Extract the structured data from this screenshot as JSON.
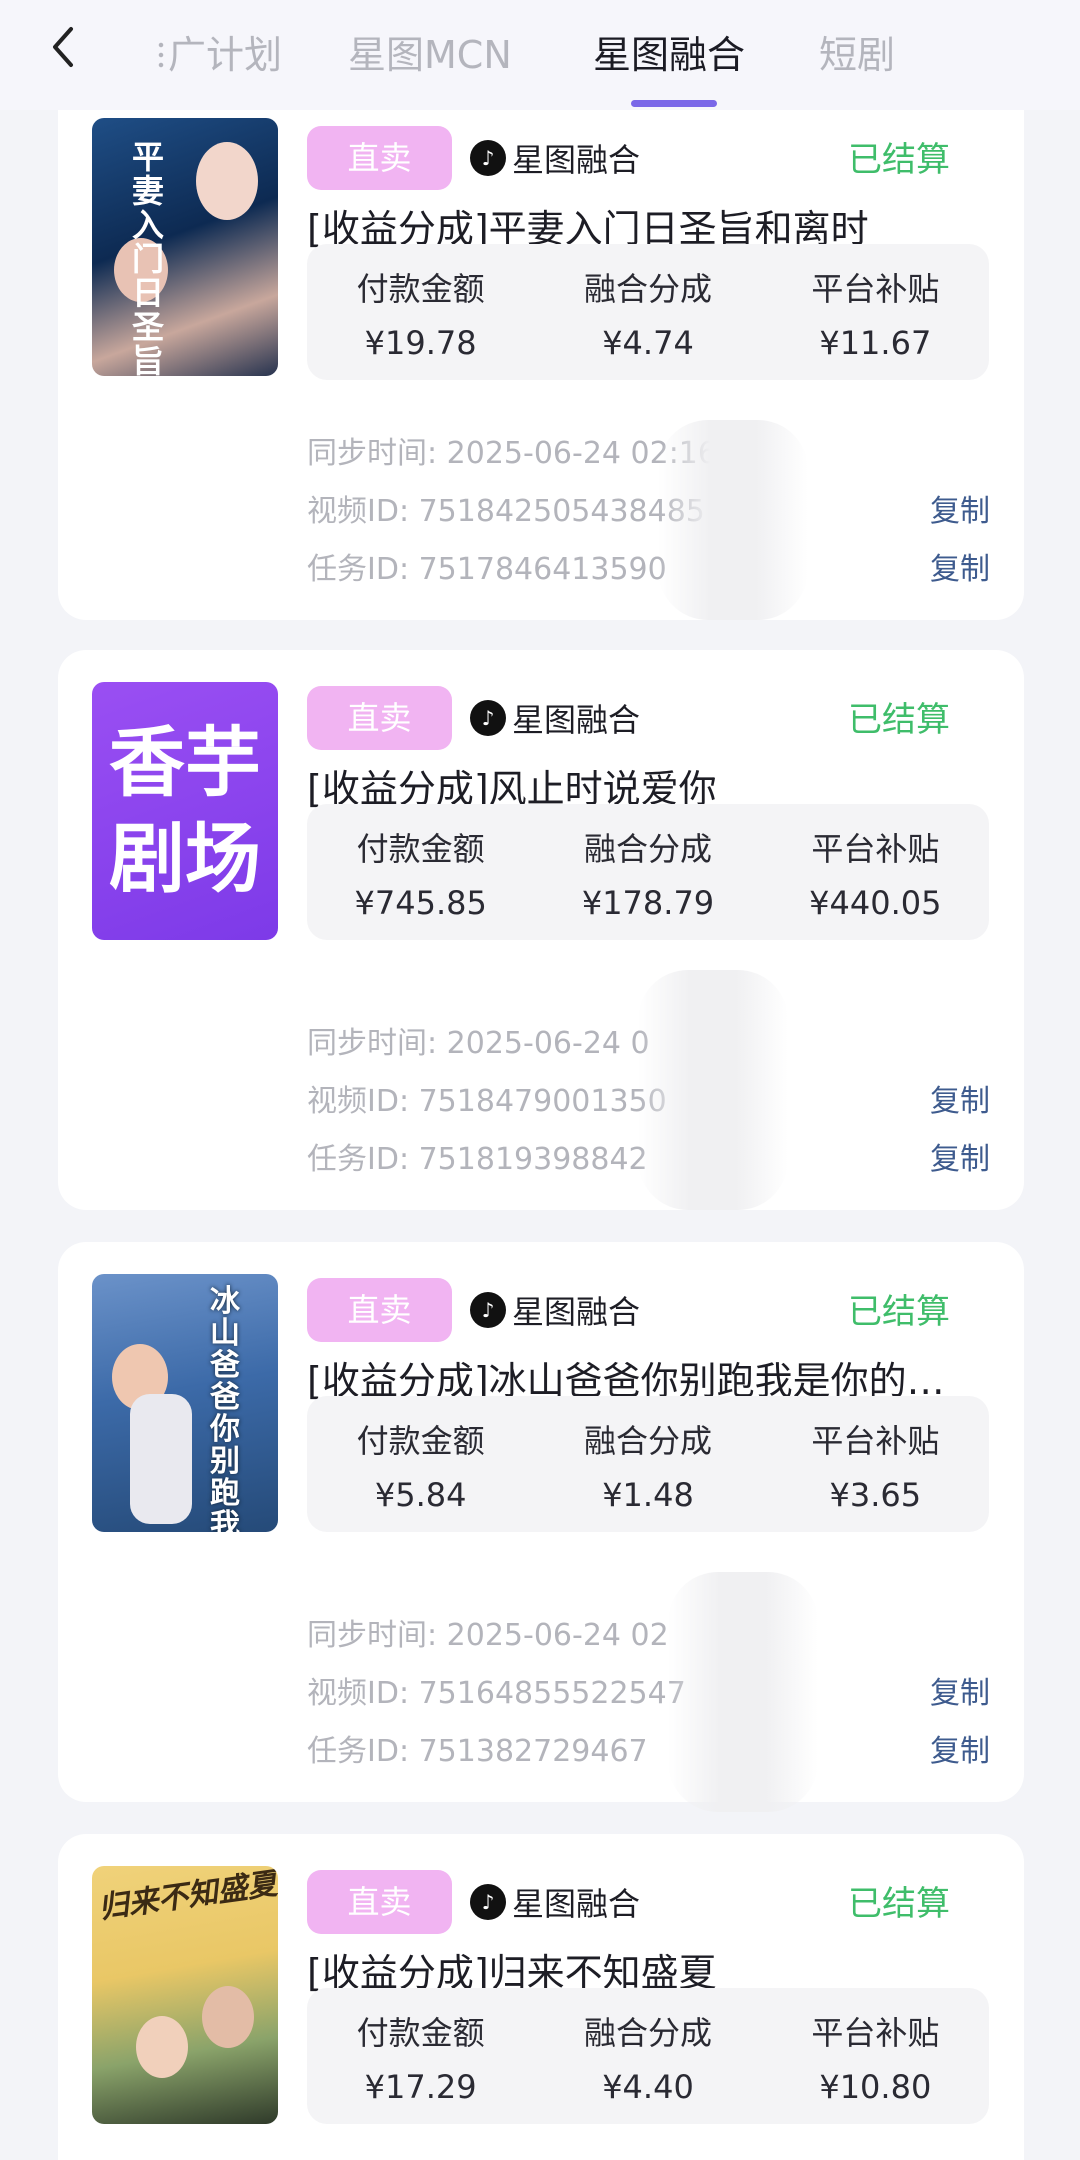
{
  "tabs": [
    "广计划",
    "星图MCN",
    "星图融合",
    "短剧"
  ],
  "active_tab": 2,
  "metric_labels": {
    "payment": "付款金额",
    "share": "融合分成",
    "subsidy": "平台补贴"
  },
  "copy_label": "复制",
  "cards": [
    {
      "tag": "直卖",
      "source": "星图融合",
      "status": "已结算",
      "title": "[收益分成]平妻入门日圣旨和离时",
      "payment": "¥19.78",
      "share": "¥4.74",
      "subsidy": "¥11.67",
      "sync": "同步时间: 2025-06-24 02:16:4",
      "video_id": "视频ID: 75184250543848​5",
      "task_id": "任务ID: 7517846413590",
      "poster_text": "平妻入门日 圣旨和"
    },
    {
      "tag": "直卖",
      "source": "星图融合",
      "status": "已结算",
      "title": "[收益分成]风止时说爱你",
      "payment": "¥745.85",
      "share": "¥178.79",
      "subsidy": "¥440.05",
      "sync": "同步时间: 2025-06-24 0",
      "video_id": "视频ID: 7518479001350",
      "task_id": "任务ID: 751819398842",
      "poster_text": "香芋剧场"
    },
    {
      "tag": "直卖",
      "source": "星图融合",
      "status": "已结算",
      "title": "[收益分成]冰山爸爸你别跑我是你的…",
      "payment": "¥5.84",
      "share": "¥1.48",
      "subsidy": "¥3.65",
      "sync": "同步时间: 2025-06-24 02",
      "video_id": "视频ID: 75164855522547",
      "task_id": "任务ID: 75138272946​7",
      "poster_text": "冰山爸爸你别跑 我是你的小龙宝"
    },
    {
      "tag": "直卖",
      "source": "星图融合",
      "status": "已结算",
      "title": "[收益分成]归来不知盛夏",
      "payment": "¥17.29",
      "share": "¥4.40",
      "subsidy": "¥10.80",
      "sync": "",
      "video_id": "",
      "task_id": "",
      "poster_text": "归来不知盛夏"
    }
  ]
}
